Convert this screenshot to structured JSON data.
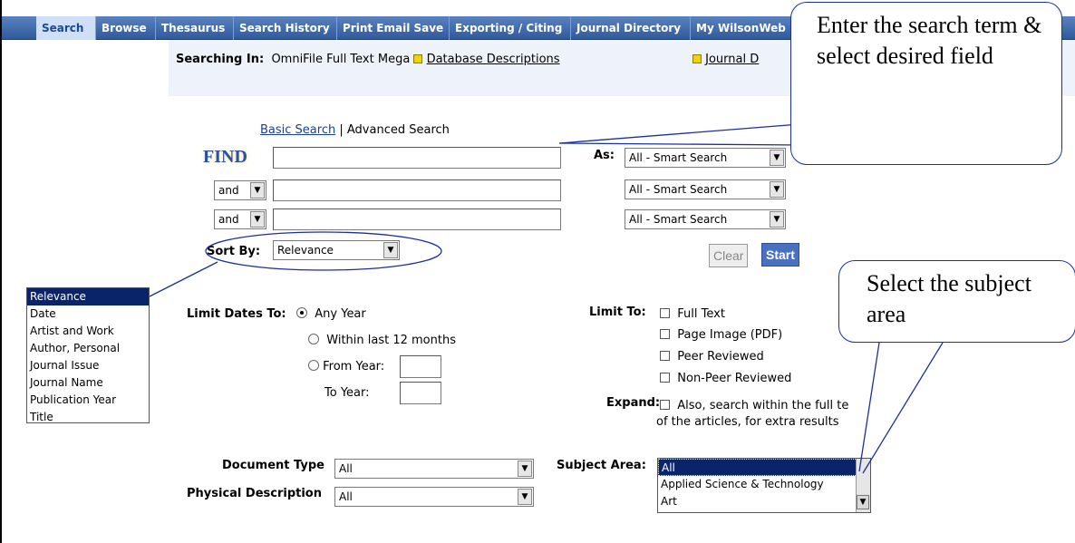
{
  "nav": {
    "items": [
      "Search",
      "Browse",
      "Thesaurus",
      "Search History",
      "Print Email Save",
      "Exporting / Citing",
      "Journal Directory",
      "My WilsonWeb"
    ]
  },
  "info": {
    "searching_label": "Searching In:",
    "database": "OmniFile Full Text Mega",
    "db_descriptions": "Database Descriptions",
    "journal_link": "Journal D"
  },
  "search_mode": {
    "basic": "Basic Search",
    "separator": "|",
    "advanced": "Advanced Search"
  },
  "find_label": "FIND",
  "as_label": "As:",
  "rows": [
    {
      "operator": "",
      "value": "",
      "field": "All - Smart Search"
    },
    {
      "operator": "and",
      "value": "",
      "field": "All - Smart Search"
    },
    {
      "operator": "and",
      "value": "",
      "field": "All - Smart Search"
    }
  ],
  "sort": {
    "label": "Sort By:",
    "value": "Relevance"
  },
  "buttons": {
    "clear": "Clear",
    "start": "Start"
  },
  "sort_options": [
    "Relevance",
    "Date",
    "Artist and Work",
    "Author, Personal",
    "Journal Issue",
    "Journal Name",
    "Publication Year",
    "Title"
  ],
  "dates": {
    "label": "Limit Dates To:",
    "any_year": "Any Year",
    "last12": "Within last 12 months",
    "from_year": "From Year:",
    "to_year": "To Year:"
  },
  "limit_to": {
    "label": "Limit To:",
    "options": [
      "Full Text",
      "Page Image (PDF)",
      "Peer Reviewed",
      "Non-Peer Reviewed"
    ]
  },
  "expand": {
    "label": "Expand:",
    "line1": "Also, search within the full te",
    "line2": "of the articles, for extra results"
  },
  "document_type": {
    "label": "Document Type",
    "value": "All"
  },
  "physical_description": {
    "label": "Physical Description",
    "value": "All"
  },
  "subject_area": {
    "label": "Subject Area:",
    "options": [
      "All",
      "Applied Science & Technology",
      "Art"
    ]
  },
  "callouts": {
    "search_term": "Enter the search term & select desired field",
    "subject": "Select the subject area"
  }
}
